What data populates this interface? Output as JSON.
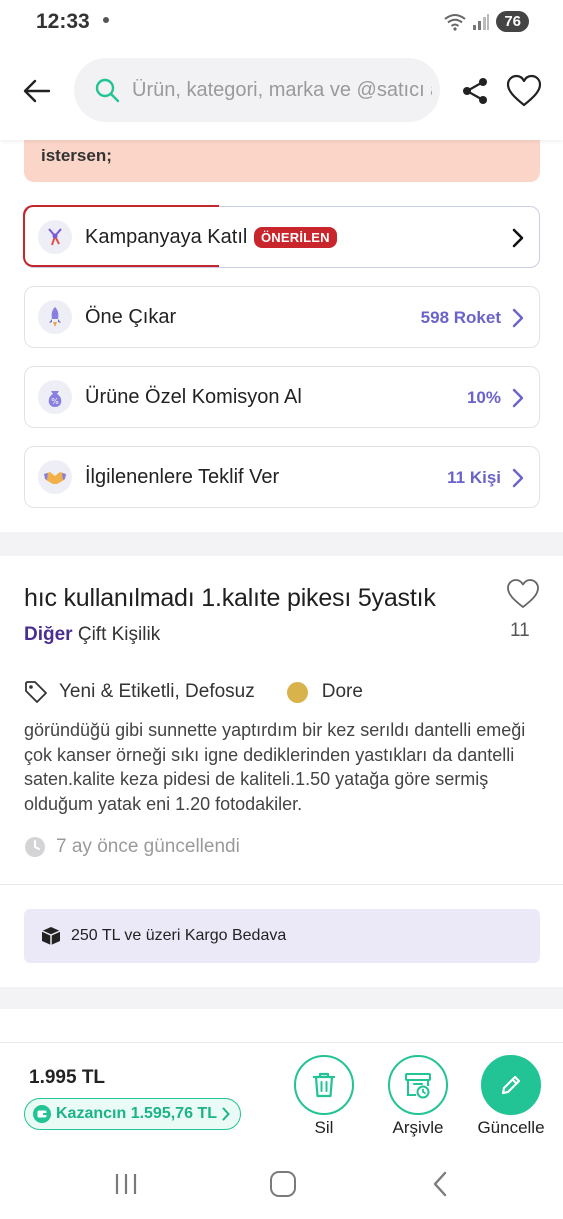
{
  "status_bar": {
    "time": "12:33",
    "battery": "76"
  },
  "header": {
    "search_placeholder": "Ürün, kategori, marka ve @satıcı ara"
  },
  "warning": {
    "text": "istersen;"
  },
  "actions": [
    {
      "label": "Kampanyaya Katıl",
      "badge": "ÖNERİLEN",
      "value": "",
      "icon": "campaign-icon"
    },
    {
      "label": "Öne Çıkar",
      "value": "598 Roket",
      "icon": "rocket-icon"
    },
    {
      "label": "Ürüne Özel Komisyon Al",
      "value": "10%",
      "icon": "commission-bag-icon"
    },
    {
      "label": "İlgilenenlere Teklif Ver",
      "value": "11 Kişi",
      "icon": "handshake-icon"
    }
  ],
  "product": {
    "title": "hıc kullanılmadı 1.kalıte pikesı 5yastık",
    "like_count": "11",
    "category_main": "Diğer",
    "category_sub": "Çift Kişilik",
    "condition": "Yeni & Etiketli, Defosuz",
    "color_name": "Dore",
    "color_hex": "#d8b24a",
    "description": "göründüğü gibi sunnette yaptırdım bir kez serıldı dantelli emeği çok kanser örneği sıkı igne dediklerinden yastıkları da dantelli saten.kalite keza pidesi de kaliteli.1.50 yatağa göre sermiş olduğum yatak eni 1.20 fotodakiler.",
    "updated": "7 ay önce güncellendi"
  },
  "shipping": {
    "text": "250 TL ve üzeri Kargo Bedava"
  },
  "bottom": {
    "price": "1.995 TL",
    "earning": "Kazancın 1.595,76 TL",
    "delete_label": "Sil",
    "archive_label": "Arşivle",
    "update_label": "Güncelle"
  },
  "colors": {
    "accent_green": "#22c394",
    "accent_purple": "#6b63c9",
    "badge_red": "#c8262c",
    "warning_bg": "#fbd5c8"
  }
}
